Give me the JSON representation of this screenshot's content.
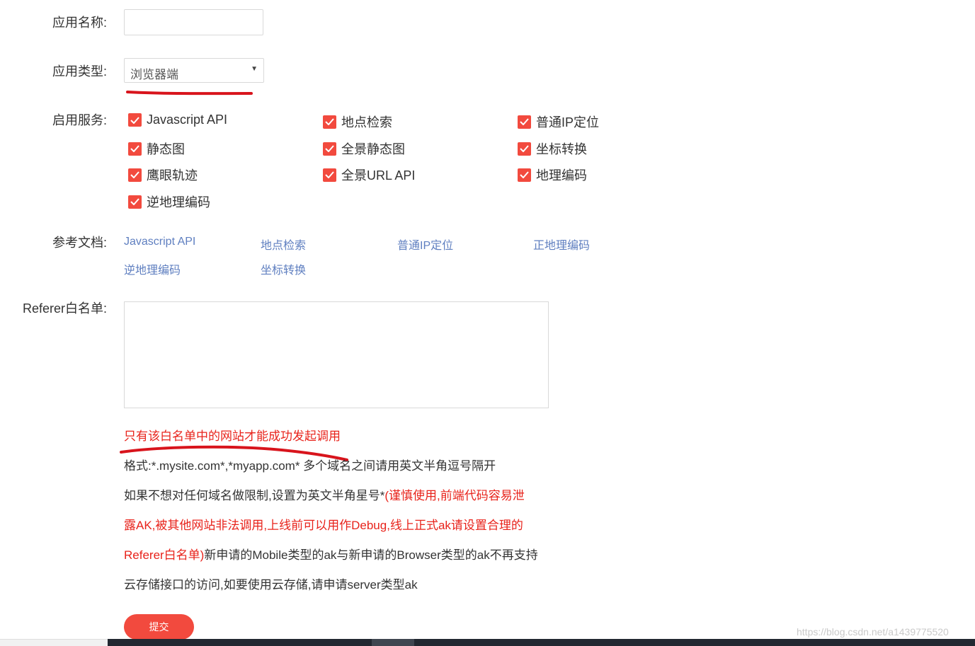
{
  "form": {
    "app_name_label": "应用名称:",
    "app_name_value": "",
    "app_type_label": "应用类型:",
    "app_type_value": "浏览器端",
    "services_label": "启用服务:",
    "services": [
      {
        "label": "Javascript API",
        "checked": true
      },
      {
        "label": "地点检索",
        "checked": true
      },
      {
        "label": "普通IP定位",
        "checked": true
      },
      {
        "label": "静态图",
        "checked": true
      },
      {
        "label": "全景静态图",
        "checked": true
      },
      {
        "label": "坐标转换",
        "checked": true
      },
      {
        "label": "鹰眼轨迹",
        "checked": true
      },
      {
        "label": "全景URL API",
        "checked": true
      },
      {
        "label": "地理编码",
        "checked": true
      },
      {
        "label": "逆地理编码",
        "checked": true
      }
    ],
    "docs_label": "参考文档:",
    "docs": [
      "Javascript API",
      "地点检索",
      "普通IP定位",
      "正地理编码",
      "逆地理编码",
      "坐标转换"
    ],
    "referer_label": "Referer白名单:",
    "referer_value": "",
    "hint_line1": "只有该白名单中的网站才能成功发起调用",
    "hint_line2": "格式:*.mysite.com*,*myapp.com* 多个域名之间请用英文半角逗号隔开",
    "hint_line3_prefix": "如果不想对任何域名做限制,设置为英文半角星号*",
    "hint_line3_red": "(谨慎使用,前端代码容易泄",
    "hint_line4_red": "露AK,被其他网站非法调用,上线前可以用作Debug,线上正式ak请设置合理的",
    "hint_line5_red": "Referer白名单)",
    "hint_line5_rest": "新申请的Mobile类型的ak与新申请的Browser类型的ak不再支持",
    "hint_line6": "云存储接口的访问,如要使用云存储,请申请server类型ak",
    "submit_label": "提交"
  },
  "watermark": "https://blog.csdn.net/a1439775520",
  "colors": {
    "accent": "#f24a3e",
    "link": "#5f7fc0",
    "warning_text": "#e8231b",
    "annotation_ink": "#d8141c"
  },
  "icons": {
    "checkbox": "check-icon",
    "dropdown": "triangle-down-icon"
  }
}
